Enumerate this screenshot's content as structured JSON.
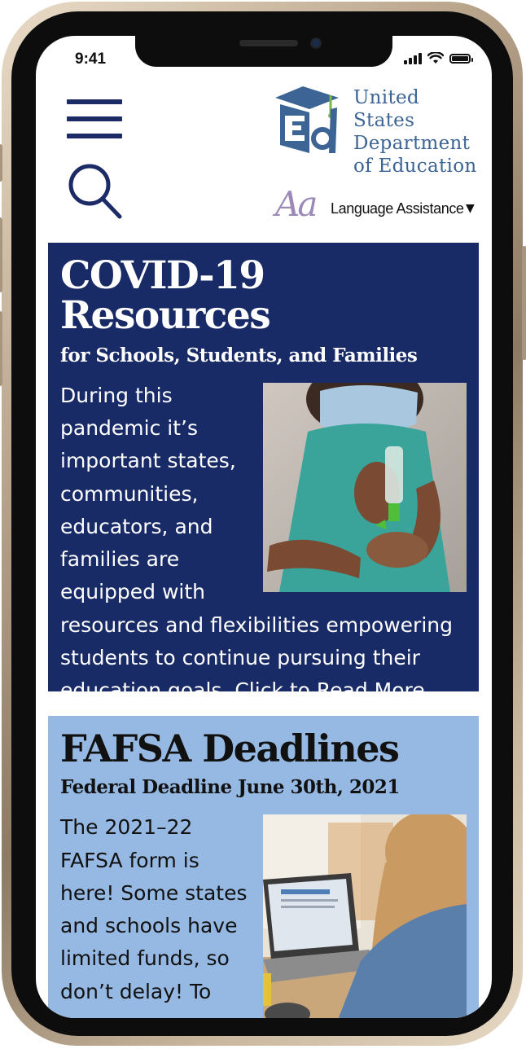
{
  "status_bar": {
    "time": "9:41"
  },
  "header": {
    "logo_lines": [
      "United States",
      "Department",
      "of Education"
    ],
    "language": {
      "glyph": "Aa",
      "label": "Language Assistance",
      "caret": "▼"
    }
  },
  "cards": [
    {
      "title": "COVID-19 Resources",
      "subtitle": "for Schools, Students, and Families",
      "body": "During this pandemic it’s important states, communities, educators, and families are equipped with resources and flexibilities empowering students to continue pursuing their education goals. Click to Read More"
    },
    {
      "title": "FAFSA Deadlines",
      "subtitle": "Federal Deadline June 30th, 2021",
      "body": "The 2021–22 FAFSA form is here! Some states and schools have limited funds, so don’t delay! To"
    }
  ],
  "colors": {
    "covid_card": "#192b67",
    "fafsa_card": "#96b9e3",
    "logo_blue": "#3c6495",
    "logo_green": "#7ab648",
    "menu_icon": "#1c2b66",
    "language_aa": "#9b8ab8"
  },
  "icons": [
    "menu-icon",
    "search-icon",
    "signal-icon",
    "wifi-icon",
    "battery-icon",
    "ed-logo-icon",
    "caret-down-icon"
  ]
}
